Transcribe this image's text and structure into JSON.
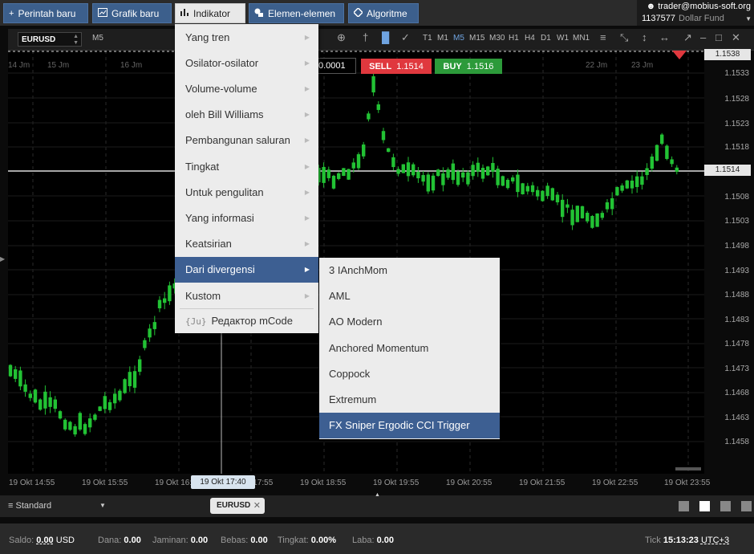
{
  "topbar": {
    "buttons": [
      {
        "label": "Perintah baru",
        "icon": "+"
      },
      {
        "label": "Grafik baru",
        "icon": "chart-icon"
      },
      {
        "label": "Indikator",
        "icon": "bars-icon"
      },
      {
        "label": "Elemen-elemen",
        "icon": "shapes-icon"
      },
      {
        "label": "Algoritme",
        "icon": "diamond-icon"
      }
    ],
    "account": {
      "email": "trader@mobius-soft.org",
      "id": "1137577",
      "fund": "Dollar Fund"
    }
  },
  "toolbar": {
    "symbol": "EURUSD",
    "timeframe_current": "M5",
    "timeframes": [
      "T1",
      "M1",
      "M5",
      "M15",
      "M30",
      "H1",
      "H4",
      "D1",
      "W1",
      "MN1"
    ],
    "selected_timeframe": "M5"
  },
  "trade": {
    "qty": "0.0001",
    "sell_label": "SELL",
    "sell_price": "1.1514",
    "buy_label": "BUY",
    "buy_price": "1.1516"
  },
  "chart": {
    "top_dates": [
      "14 Jm",
      "15 Jm",
      "16 Jm",
      "22 Jm",
      "23 Jm"
    ],
    "price_labels": [
      "1.1533",
      "1.1528",
      "1.1523",
      "1.1518",
      "1.1508",
      "1.1503",
      "1.1498",
      "1.1493",
      "1.1488",
      "1.1483",
      "1.1478",
      "1.1473",
      "1.1468",
      "1.1463",
      "1.1458"
    ],
    "price_top_box": "1.1538",
    "price_current_box": "1.1514",
    "time_labels": [
      "19 Okt 14:55",
      "19 Okt 15:55",
      "19 Okt 16:55",
      "19 Okt 17:55",
      "19 Okt 18:55",
      "19 Okt 19:55",
      "19 Okt 20:55",
      "19 Okt 21:55",
      "19 Okt 22:55",
      "19 Okt 23:55"
    ],
    "time_cursor": "19 Okt 17:40",
    "bull_color": "#22c234",
    "bear_color": "#22c234"
  },
  "menu": {
    "items": [
      {
        "label": "Yang tren",
        "has_sub": true
      },
      {
        "label": "Osilator-osilator",
        "has_sub": true
      },
      {
        "label": "Volume-volume",
        "has_sub": true
      },
      {
        "label": "oleh Bill Williams",
        "has_sub": true
      },
      {
        "label": "Pembangunan saluran",
        "has_sub": true
      },
      {
        "label": "Tingkat",
        "has_sub": true
      },
      {
        "label": "Untuk pengulitan",
        "has_sub": true
      },
      {
        "label": "Yang informasi",
        "has_sub": true
      },
      {
        "label": "Keatsirian",
        "has_sub": true
      },
      {
        "label": "Dari divergensi",
        "has_sub": true
      },
      {
        "label": "Kustom",
        "has_sub": true
      }
    ],
    "mcode_label": "Редактор mCode",
    "mcode_icon": "{Ju}"
  },
  "submenu": {
    "items": [
      "3 IAnchMom",
      "AML",
      "AO Modern",
      "Anchored Momentum",
      "Coppock",
      "Extremum",
      "FX Sniper Ergodic CCI Trigger"
    ]
  },
  "bottom": {
    "workspace": "Standard",
    "tab_label": "EURUSD"
  },
  "status": {
    "saldo_label": "Saldo:",
    "saldo_value": "0.00",
    "saldo_currency": "USD",
    "dana_label": "Dana:",
    "dana_value": "0.00",
    "jaminan_label": "Jaminan:",
    "jaminan_value": "0.00",
    "bebas_label": "Bebas:",
    "bebas_value": "0.00",
    "tingkat_label": "Tingkat:",
    "tingkat_value": "0.00%",
    "laba_label": "Laba:",
    "laba_value": "0.00",
    "tick_label": "Tick",
    "time": "15:13:23",
    "tz": "UTC+3"
  }
}
